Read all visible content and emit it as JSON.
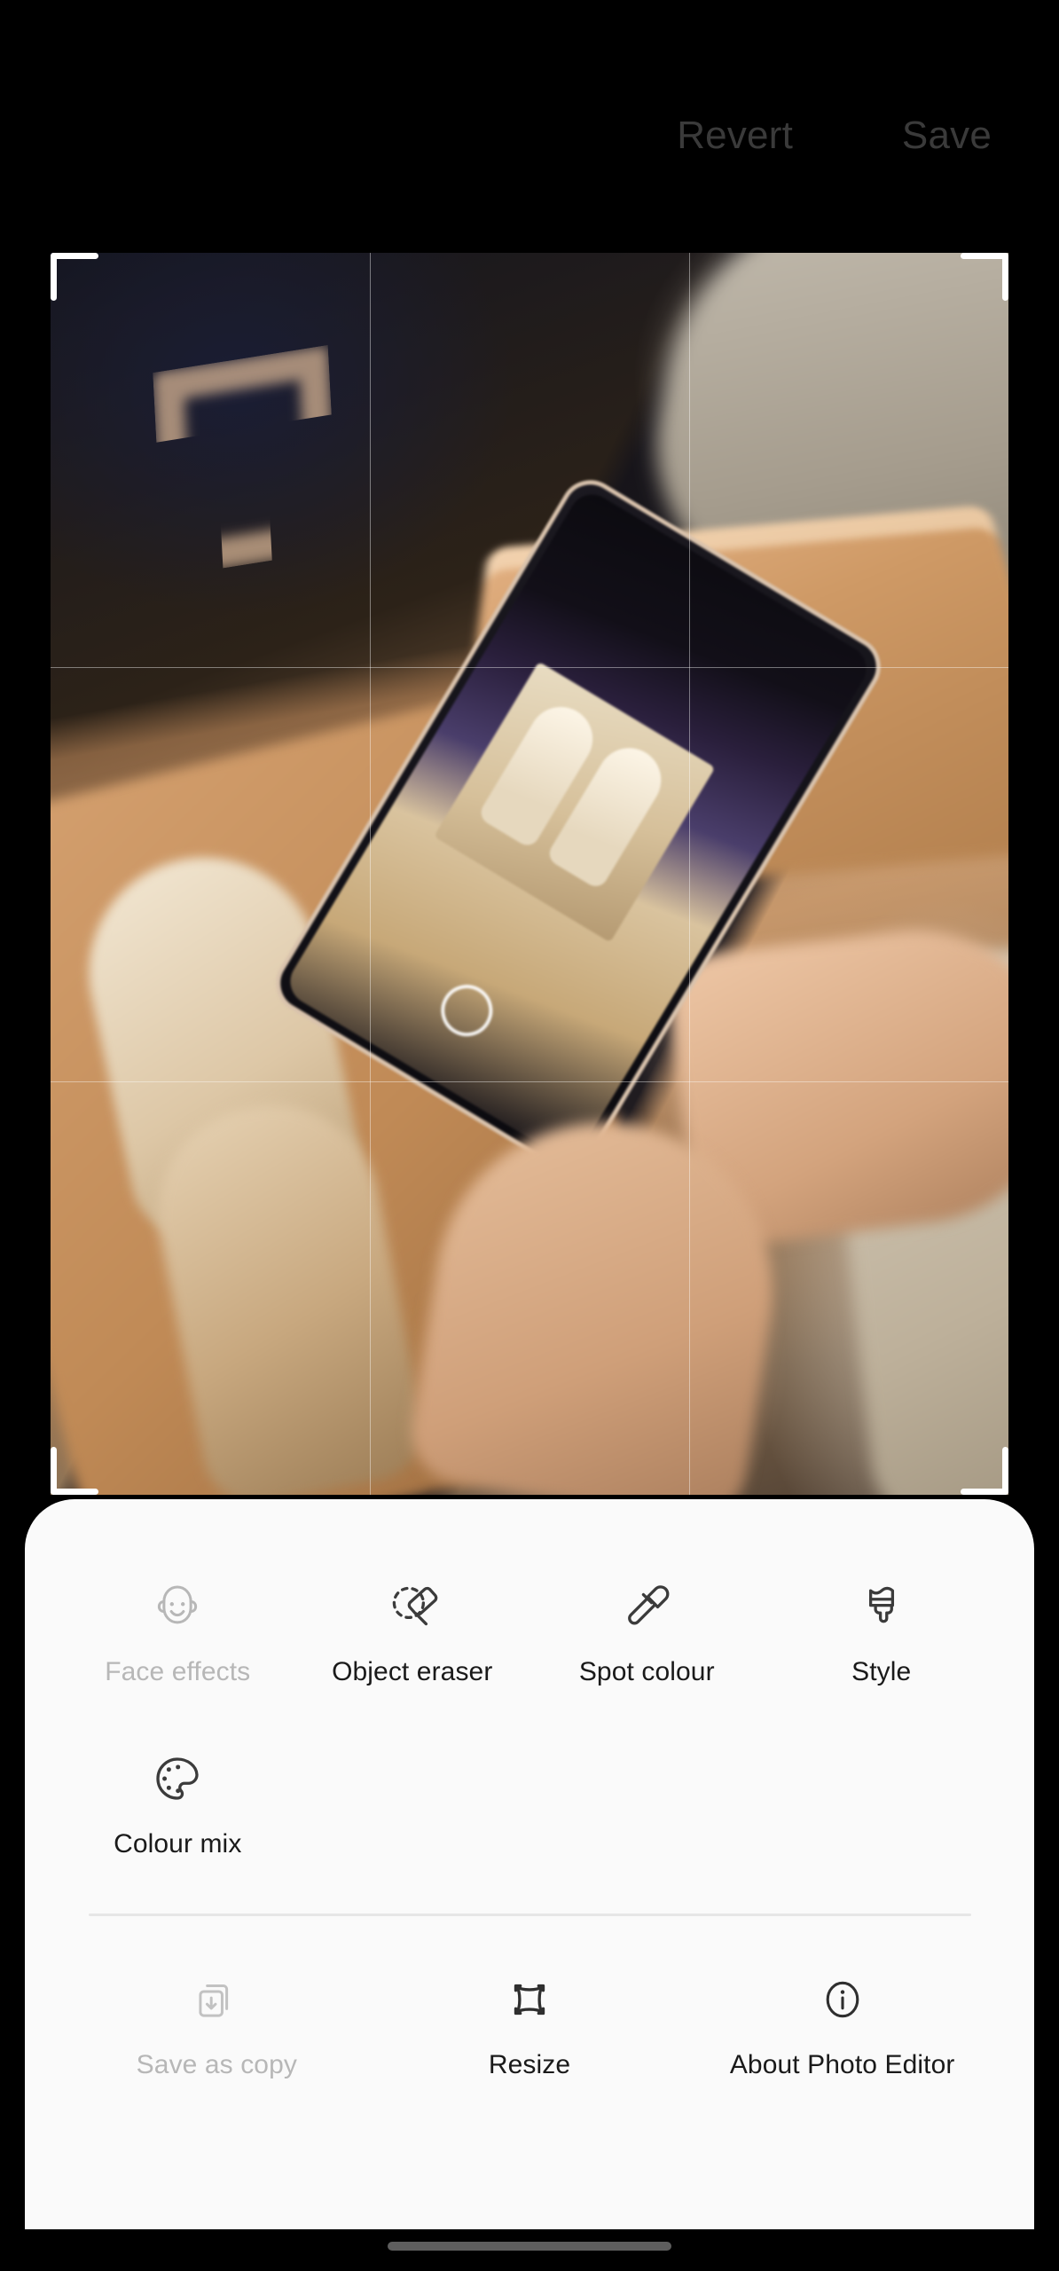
{
  "app": {
    "name": "Photo Editor"
  },
  "topbar": {
    "revert_label": "Revert",
    "save_label": "Save",
    "revert_icon": "revert-text-button",
    "save_icon": "save-text-button",
    "text_color": "#3a3a3a"
  },
  "canvas": {
    "grid": "rule-of-thirds",
    "crop_handles": [
      "top-left",
      "top-right",
      "bottom-left",
      "bottom-right"
    ],
    "handle_color": "#ffffff",
    "photo_description": "Hands holding a smartphone photographing beige sneakers in an open shoebox on a tan tray"
  },
  "sheet": {
    "background": "#fafafa",
    "tools_row": [
      {
        "label": "Face effects",
        "icon": "face-smile-icon",
        "enabled": false
      },
      {
        "label": "Object eraser",
        "icon": "object-eraser-icon",
        "enabled": true
      },
      {
        "label": "Spot colour",
        "icon": "eyedropper-icon",
        "enabled": true
      },
      {
        "label": "Style",
        "icon": "paint-brush-icon",
        "enabled": true
      }
    ],
    "tools_row_second": [
      {
        "label": "Colour mix",
        "icon": "colour-palette-icon",
        "enabled": true
      }
    ],
    "actions_row": [
      {
        "label": "Save as copy",
        "icon": "save-as-copy-icon",
        "enabled": false
      },
      {
        "label": "Resize",
        "icon": "resize-icon",
        "enabled": true
      },
      {
        "label": "About Photo Editor",
        "icon": "info-circle-icon",
        "enabled": true
      }
    ],
    "divider_color": "#e6e6e6"
  },
  "navbar": {
    "home_indicator": "home-indicator-bar",
    "color": "#5e5e5e"
  }
}
